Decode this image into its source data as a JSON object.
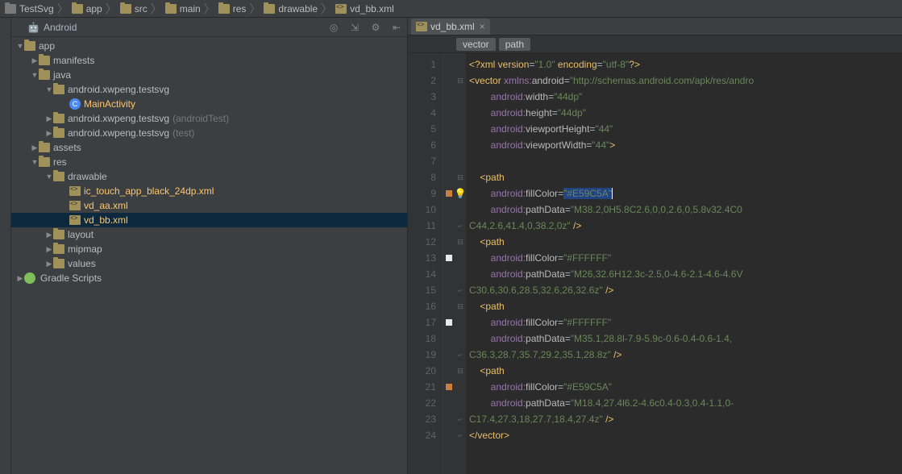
{
  "breadcrumb": [
    {
      "label": "TestSvg",
      "icon": "folder-grey"
    },
    {
      "label": "app",
      "icon": "folder"
    },
    {
      "label": "src",
      "icon": "folder"
    },
    {
      "label": "main",
      "icon": "folder"
    },
    {
      "label": "res",
      "icon": "folder"
    },
    {
      "label": "drawable",
      "icon": "folder"
    },
    {
      "label": "vd_bb.xml",
      "icon": "xml",
      "active": true
    }
  ],
  "project_header": {
    "label": "Android"
  },
  "tree": {
    "app": "app",
    "manifests": "manifests",
    "java": "java",
    "pkg1": "android.xwpeng.testsvg",
    "main_activity": "MainActivity",
    "pkg2": "android.xwpeng.testsvg",
    "pkg2_suffix": "(androidTest)",
    "pkg3": "android.xwpeng.testsvg",
    "pkg3_suffix": "(test)",
    "assets": "assets",
    "res": "res",
    "drawable": "drawable",
    "f1": "ic_touch_app_black_24dp.xml",
    "f2": "vd_aa.xml",
    "f3": "vd_bb.xml",
    "layout": "layout",
    "mipmap": "mipmap",
    "values": "values",
    "gradle": "Gradle Scripts"
  },
  "tabs": [
    {
      "label": "vd_bb.xml",
      "active": true
    }
  ],
  "crumbs": [
    "vector",
    "path"
  ],
  "line_numbers": [
    "1",
    "2",
    "3",
    "4",
    "5",
    "6",
    "7",
    "8",
    "9",
    "10",
    "11",
    "12",
    "13",
    "14",
    "15",
    "16",
    "17",
    "18",
    "19",
    "20",
    "21",
    "22",
    "23",
    "24"
  ],
  "marks": {
    "9": "bulb",
    "13": "white",
    "17": "white",
    "21": "orange",
    "9a": "orange"
  },
  "code": {
    "l1_a": "<?",
    "l1_b": "xml version",
    "l1_c": "=",
    "l1_d": "\"1.0\"",
    "l1_e": " encoding",
    "l1_f": "=",
    "l1_g": "\"utf-8\"",
    "l1_h": "?>",
    "l2_a": "<",
    "l2_b": "vector ",
    "l2_c": "xmlns:",
    "l2_d": "android",
    "l2_e": "=",
    "l2_f": "\"http://schemas.android.com/apk/res/andro",
    "l3_a": "android:",
    "l3_b": "width",
    "l3_c": "=",
    "l3_d": "\"44dp\"",
    "l4_a": "android:",
    "l4_b": "height",
    "l4_c": "=",
    "l4_d": "\"44dp\"",
    "l5_a": "android:",
    "l5_b": "viewportHeight",
    "l5_c": "=",
    "l5_d": "\"44\"",
    "l6_a": "android:",
    "l6_b": "viewportWidth",
    "l6_c": "=",
    "l6_d": "\"44\"",
    "l6_e": ">",
    "l8_a": "<",
    "l8_b": "path",
    "l9_a": "android:",
    "l9_b": "fillColor",
    "l9_c": "=",
    "l9_d": "\"",
    "l9_e": "#E59C5A",
    "l9_f": "\"",
    "l10_a": "android:",
    "l10_b": "pathData",
    "l10_c": "=",
    "l10_d": "\"M38.2,0H5.8C2.6,0,0,2.6,0,5.8v32.4C0",
    "l11_a": "C44,2.6,41.4,0,38.2,0z\"",
    "l11_b": " />",
    "l12_a": "<",
    "l12_b": "path",
    "l13_a": "android:",
    "l13_b": "fillColor",
    "l13_c": "=",
    "l13_d": "\"#FFFFFF\"",
    "l14_a": "android:",
    "l14_b": "pathData",
    "l14_c": "=",
    "l14_d": "\"M26,32.6H12.3c-2.5,0-4.6-2.1-4.6-4.6V",
    "l15_a": "C30.6,30.6,28.5,32.6,26,32.6z\"",
    "l15_b": " />",
    "l16_a": "<",
    "l16_b": "path",
    "l17_a": "android:",
    "l17_b": "fillColor",
    "l17_c": "=",
    "l17_d": "\"#FFFFFF\"",
    "l18_a": "android:",
    "l18_b": "pathData",
    "l18_c": "=",
    "l18_d": "\"M35.1,28.8l-7.9-5.9c-0.6-0.4-0.6-1.4,",
    "l19_a": "C36.3,28.7,35.7,29.2,35.1,28.8z\"",
    "l19_b": " />",
    "l20_a": "<",
    "l20_b": "path",
    "l21_a": "android:",
    "l21_b": "fillColor",
    "l21_c": "=",
    "l21_d": "\"#E59C5A\"",
    "l22_a": "android:",
    "l22_b": "pathData",
    "l22_c": "=",
    "l22_d": "\"M18.4,27.4l6.2-4.6c0.4-0.3,0.4-1.1,0-",
    "l23_a": "C17.4,27.3,18,27.7,18.4,27.4z\"",
    "l23_b": " />",
    "l24_a": "</",
    "l24_b": "vector",
    "l24_c": ">"
  }
}
